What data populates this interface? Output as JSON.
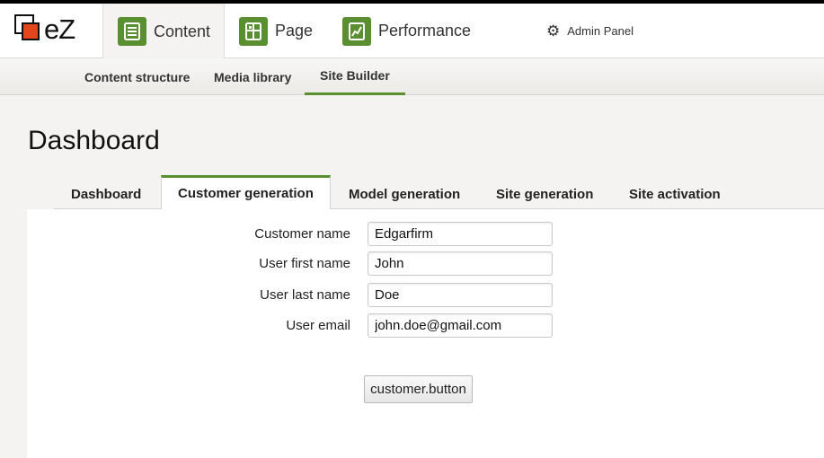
{
  "logo": {
    "text": "eZ"
  },
  "mainnav": {
    "tabs": [
      {
        "label": "Content",
        "icon": "content-icon",
        "active": true
      },
      {
        "label": "Page",
        "icon": "page-icon",
        "active": false
      },
      {
        "label": "Performance",
        "icon": "performance-icon",
        "active": false
      }
    ],
    "admin_label": "Admin Panel"
  },
  "subnav": {
    "items": [
      {
        "label": "Content structure",
        "active": false
      },
      {
        "label": "Media library",
        "active": false
      },
      {
        "label": "Site Builder",
        "active": true
      }
    ]
  },
  "page": {
    "title": "Dashboard"
  },
  "tabs": [
    {
      "label": "Dashboard",
      "active": false
    },
    {
      "label": "Customer generation",
      "active": true
    },
    {
      "label": "Model generation",
      "active": false
    },
    {
      "label": "Site generation",
      "active": false
    },
    {
      "label": "Site activation",
      "active": false
    }
  ],
  "form": {
    "fields": [
      {
        "label": "Customer name",
        "value": "Edgarfirm"
      },
      {
        "label": "User first name",
        "value": "John"
      },
      {
        "label": "User last name",
        "value": "Doe"
      },
      {
        "label": "User email",
        "value": "john.doe@gmail.com"
      }
    ],
    "button_label": "customer.button"
  },
  "colors": {
    "accent": "#5a8f31",
    "logo_orange": "#e2461a",
    "topbar": "#000000"
  }
}
